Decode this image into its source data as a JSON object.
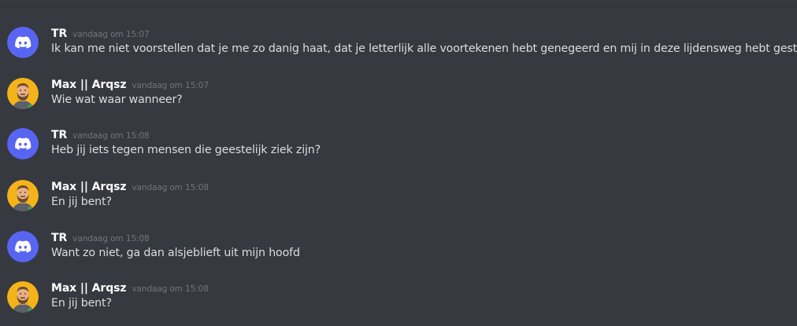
{
  "messages": [
    {
      "author": "TR",
      "avatar": "discord-logo-icon",
      "timestamp": "vandaag om 15:07",
      "text": "Ik kan me niet voorstellen dat je me zo danig haat, dat je letterlijk alle voortekenen hebt genegeerd en mij in deze lijdensweg hebt gestopt"
    },
    {
      "author": "Max || Arqsz",
      "avatar": "bearded-man-avatar-icon",
      "timestamp": "vandaag om 15:07",
      "text": "Wie wat waar wanneer?"
    },
    {
      "author": "TR",
      "avatar": "discord-logo-icon",
      "timestamp": "vandaag om 15:08",
      "text": "Heb jij iets tegen mensen die geestelijk ziek zijn?"
    },
    {
      "author": "Max || Arqsz",
      "avatar": "bearded-man-avatar-icon",
      "timestamp": "vandaag om 15:08",
      "text": "En jij bent?"
    },
    {
      "author": "TR",
      "avatar": "discord-logo-icon",
      "timestamp": "vandaag om 15:08",
      "text": "Want zo niet, ga dan alsjeblieft uit mijn hoofd"
    },
    {
      "author": "Max || Arqsz",
      "avatar": "bearded-man-avatar-icon",
      "timestamp": "vandaag om 15:08",
      "text": "En jij bent?"
    }
  ],
  "colors": {
    "background": "#36393f",
    "discord_blurple": "#5865f2",
    "username": "#ffffff",
    "timestamp": "#72767d",
    "message_text": "#dcddde",
    "avatar_yellow": "#f5b31a"
  }
}
